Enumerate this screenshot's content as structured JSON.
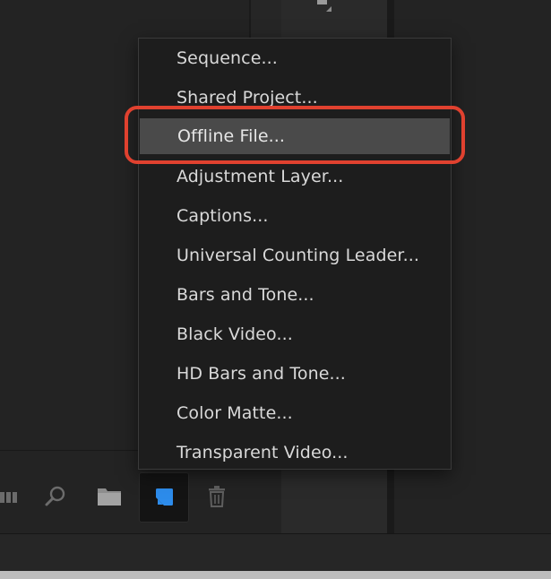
{
  "menu": {
    "items": [
      {
        "label": "Sequence...",
        "selected": false
      },
      {
        "label": "Shared Project...",
        "selected": false
      },
      {
        "label": "Offline File...",
        "selected": true
      },
      {
        "label": "Adjustment Layer...",
        "selected": false
      },
      {
        "label": "Captions...",
        "selected": false
      },
      {
        "label": "Universal Counting Leader...",
        "selected": false
      },
      {
        "label": "Bars and Tone...",
        "selected": false
      },
      {
        "label": "Black Video...",
        "selected": false
      },
      {
        "label": "HD Bars and Tone...",
        "selected": false
      },
      {
        "label": "Color Matte...",
        "selected": false
      },
      {
        "label": "Transparent Video...",
        "selected": false
      }
    ]
  },
  "toolbar": {
    "icons": [
      "list-view-icon",
      "search-icon",
      "folder-icon",
      "new-item-icon",
      "trash-icon"
    ]
  },
  "colors": {
    "accent_blue": "#2d8ceb",
    "highlight_ring": "#e0412f",
    "menu_bg": "#1d1d1d",
    "selected_bg": "#4a4a4a"
  }
}
